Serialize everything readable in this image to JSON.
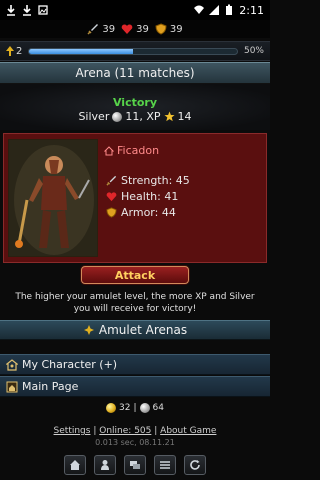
{
  "status_bar": {
    "time": "2:11"
  },
  "stats": {
    "strength": "39",
    "health": "39",
    "armor": "39"
  },
  "level": {
    "value": "2",
    "progress_percent": 50,
    "progress_label": "50%"
  },
  "banner": {
    "title": "Arena (11 matches)"
  },
  "result": {
    "outcome": "Victory",
    "rewards": {
      "silver_label": "Silver",
      "silver_value": "11, XP",
      "xp_value": "14"
    }
  },
  "opponent": {
    "name": "Ficadon",
    "strength": "Strength: 45",
    "health": "Health: 41",
    "armor": "Armor: 44"
  },
  "attack_label": "Attack",
  "info_text": "The higher your amulet level, the more XP and Silver you will receive for victory!",
  "menu": {
    "amulet_arenas": "Amulet Arenas",
    "my_character": "My Character (+)",
    "main_page": "Main Page"
  },
  "currency": {
    "gold": "32",
    "separator": "|",
    "silver": "64"
  },
  "footer": {
    "settings": "Settings",
    "sep1": "|",
    "online": "Online: 505",
    "sep2": "|",
    "about": "About Game",
    "timing": "0.013 sec, 08.11.21"
  },
  "colors": {
    "victory": "#57d44a",
    "attack_text": "#ffd060",
    "card_bg": "#5a0f0f"
  }
}
